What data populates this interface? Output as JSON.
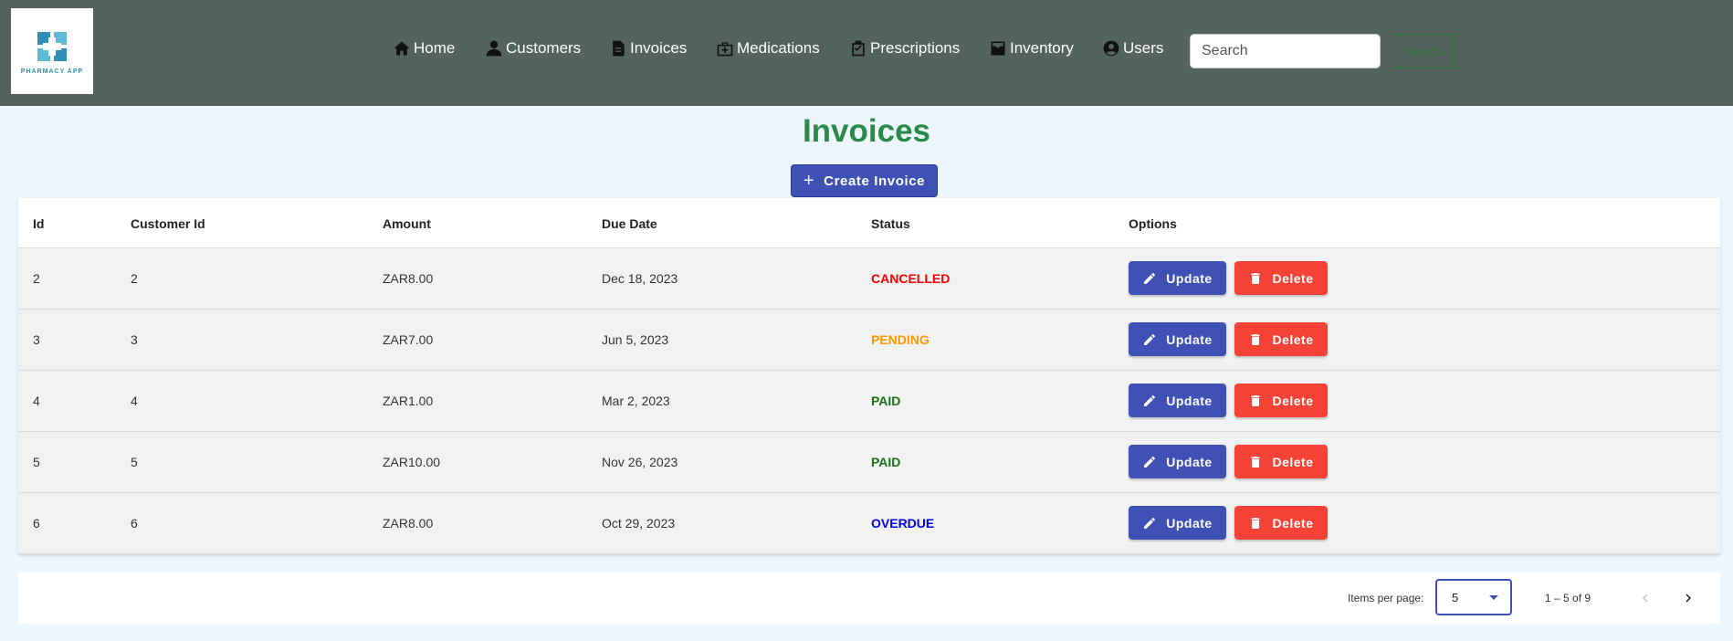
{
  "app": {
    "logo_text": "PHARMACY APP"
  },
  "nav": {
    "items": [
      {
        "label": "Home",
        "icon": "home-icon"
      },
      {
        "label": "Customers",
        "icon": "person-icon"
      },
      {
        "label": "Invoices",
        "icon": "document-icon"
      },
      {
        "label": "Medications",
        "icon": "medical-bag-icon"
      },
      {
        "label": "Prescriptions",
        "icon": "clipboard-check-icon"
      },
      {
        "label": "Inventory",
        "icon": "inventory-icon"
      },
      {
        "label": "Users",
        "icon": "account-circle-icon"
      }
    ]
  },
  "search": {
    "placeholder": "Search",
    "button_label": "Search"
  },
  "page": {
    "title": "Invoices",
    "create_button": "Create Invoice"
  },
  "table": {
    "columns": [
      "Id",
      "Customer Id",
      "Amount",
      "Due Date",
      "Status",
      "Options"
    ],
    "rows": [
      {
        "id": "2",
        "customer_id": "2",
        "amount": "ZAR8.00",
        "due_date": "Dec 18, 2023",
        "status": "CANCELLED",
        "status_color": "#ff0000"
      },
      {
        "id": "3",
        "customer_id": "3",
        "amount": "ZAR7.00",
        "due_date": "Jun 5, 2023",
        "status": "PENDING",
        "status_color": "#ff9800"
      },
      {
        "id": "4",
        "customer_id": "4",
        "amount": "ZAR1.00",
        "due_date": "Mar 2, 2023",
        "status": "PAID",
        "status_color": "#1b6e1b"
      },
      {
        "id": "5",
        "customer_id": "5",
        "amount": "ZAR10.00",
        "due_date": "Nov 26, 2023",
        "status": "PAID",
        "status_color": "#1b6e1b"
      },
      {
        "id": "6",
        "customer_id": "6",
        "amount": "ZAR8.00",
        "due_date": "Oct 29, 2023",
        "status": "OVERDUE",
        "status_color": "#0000ee"
      }
    ],
    "update_label": "Update",
    "delete_label": "Delete"
  },
  "paginator": {
    "items_per_page_label": "Items per page:",
    "items_per_page_value": "5",
    "range_label": "1 – 5 of 9"
  },
  "colors": {
    "header_bg": "#546260",
    "title_green": "#2a8a4a",
    "primary": "#3f51b5",
    "danger": "#f44336"
  }
}
